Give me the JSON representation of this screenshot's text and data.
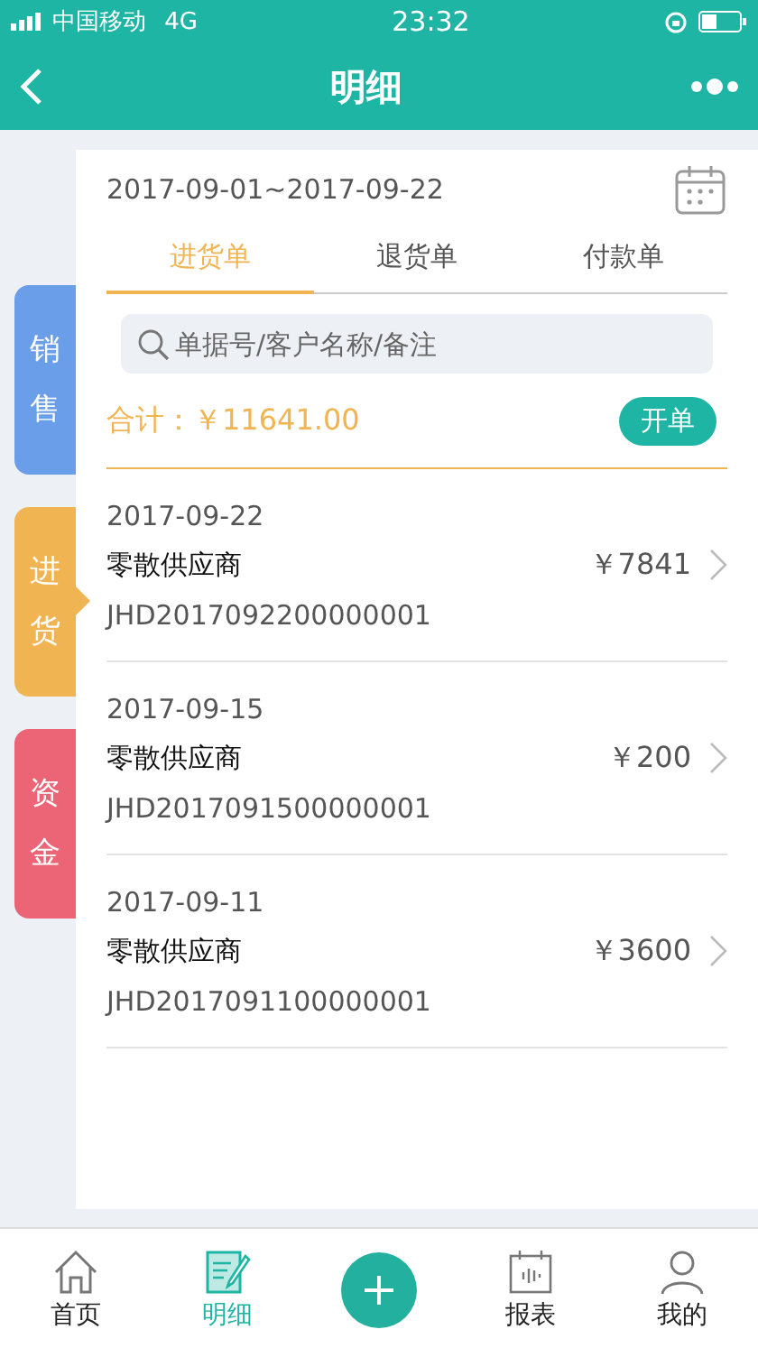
{
  "status_bar": {
    "carrier": "中国移动",
    "network": "4G",
    "time": "23:32"
  },
  "nav": {
    "title": "明细"
  },
  "side_tabs": [
    {
      "label": "销售",
      "color": "#6a9ee8",
      "selected": false
    },
    {
      "label": "进货",
      "color": "#f0b452",
      "selected": true
    },
    {
      "label": "资金",
      "color": "#eb6577",
      "selected": false
    }
  ],
  "date_range": "2017-09-01~2017-09-22",
  "tabs": [
    {
      "label": "进货单",
      "selected": true
    },
    {
      "label": "退货单",
      "selected": false
    },
    {
      "label": "付款单",
      "selected": false
    }
  ],
  "search": {
    "placeholder": "单据号/客户名称/备注"
  },
  "total": {
    "label": "合计：",
    "amount": "￥11641.00"
  },
  "new_button": "开单",
  "orders": [
    {
      "date": "2017-09-22",
      "supplier": "零散供应商",
      "number": "JHD2017092200000001",
      "amount": "￥7841"
    },
    {
      "date": "2017-09-15",
      "supplier": "零散供应商",
      "number": "JHD2017091500000001",
      "amount": "￥200"
    },
    {
      "date": "2017-09-11",
      "supplier": "零散供应商",
      "number": "JHD2017091100000001",
      "amount": "￥3600"
    }
  ],
  "bottom_tabs": [
    {
      "kind": "home",
      "label": "首页",
      "selected": false
    },
    {
      "kind": "detail",
      "label": "明细",
      "selected": true
    },
    {
      "kind": "add",
      "selected": false
    },
    {
      "kind": "report",
      "label": "报表",
      "selected": false
    },
    {
      "kind": "profile",
      "label": "我的",
      "selected": false
    }
  ]
}
